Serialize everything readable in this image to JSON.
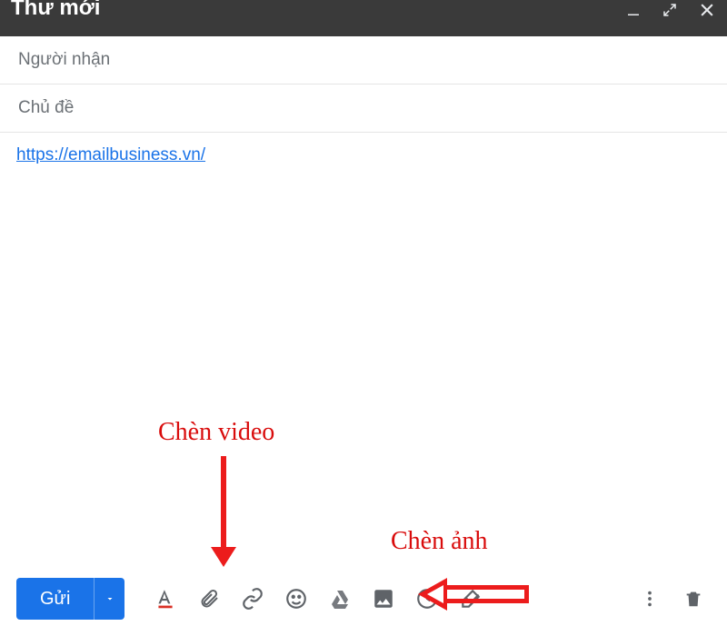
{
  "window": {
    "title": "Thư mới"
  },
  "fields": {
    "to_placeholder": "Người nhận",
    "subject_placeholder": "Chủ đề"
  },
  "body": {
    "link_text": "https://emailbusiness.vn/",
    "link_href": "https://emailbusiness.vn/"
  },
  "toolbar": {
    "send_label": "Gửi"
  },
  "annotations": {
    "video": "Chèn video",
    "image": "Chèn ảnh"
  }
}
